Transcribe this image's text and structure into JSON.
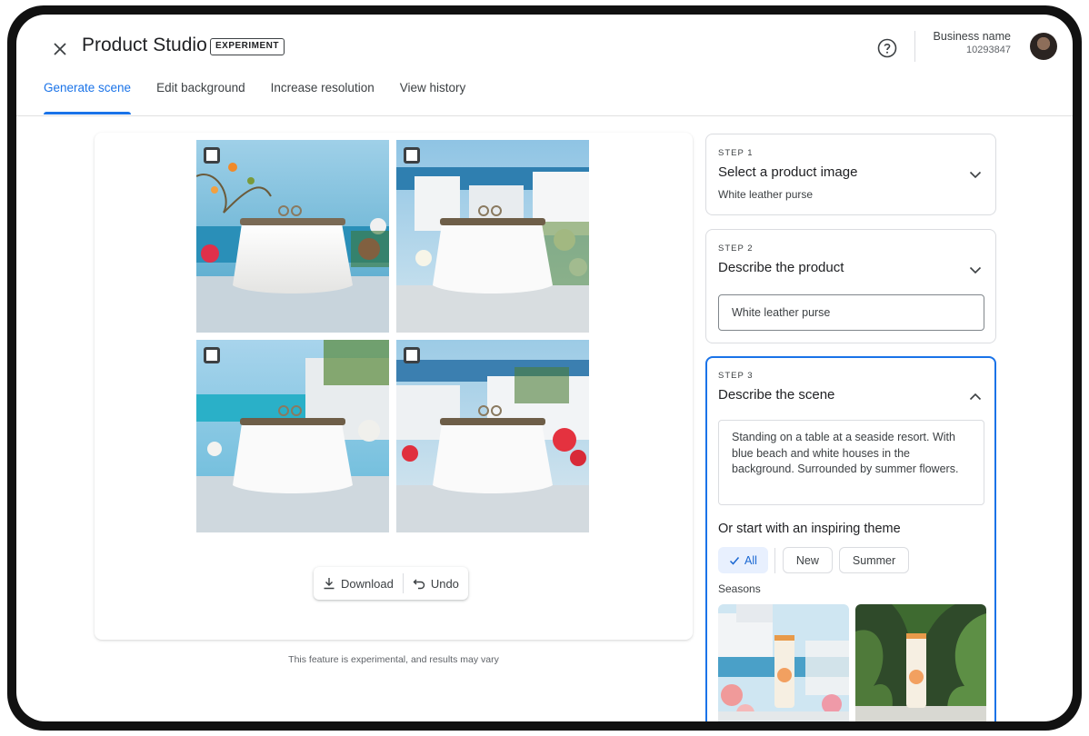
{
  "header": {
    "app_title": "Product Studio",
    "badge": "EXPERIMENT",
    "business_name": "Business name",
    "business_id": "10293847"
  },
  "tabs": [
    {
      "label": "Generate scene",
      "active": true
    },
    {
      "label": "Edit background",
      "active": false
    },
    {
      "label": "Increase resolution",
      "active": false
    },
    {
      "label": "View history",
      "active": false
    }
  ],
  "canvas": {
    "images": [
      {
        "checked": false
      },
      {
        "checked": false
      },
      {
        "checked": false
      },
      {
        "checked": false
      }
    ],
    "download_label": "Download",
    "undo_label": "Undo",
    "footnote": "This feature is experimental, and results may vary"
  },
  "steps": [
    {
      "label": "STEP 1",
      "title": "Select a product image",
      "value": "White leather purse",
      "expanded": false
    },
    {
      "label": "STEP 2",
      "title": "Describe the product",
      "value": "White leather purse",
      "expanded": false
    },
    {
      "label": "STEP 3",
      "title": "Describe the scene",
      "value": "Standing on a table at a seaside resort. With blue beach and white houses in the background. Surrounded by summer flowers.",
      "expanded": true
    }
  ],
  "themes": {
    "heading": "Or start with an inspiring theme",
    "chips": [
      {
        "label": "All",
        "selected": true
      },
      {
        "label": "New",
        "selected": false
      },
      {
        "label": "Summer",
        "selected": false
      }
    ],
    "section_label": "Seasons"
  },
  "colors": {
    "accent": "#1a73e8",
    "chip_selected_bg": "#e8f0fe"
  },
  "icons": [
    "close-icon",
    "help-icon",
    "chevron-down-icon",
    "chevron-up-icon",
    "download-icon",
    "undo-icon",
    "check-icon"
  ]
}
